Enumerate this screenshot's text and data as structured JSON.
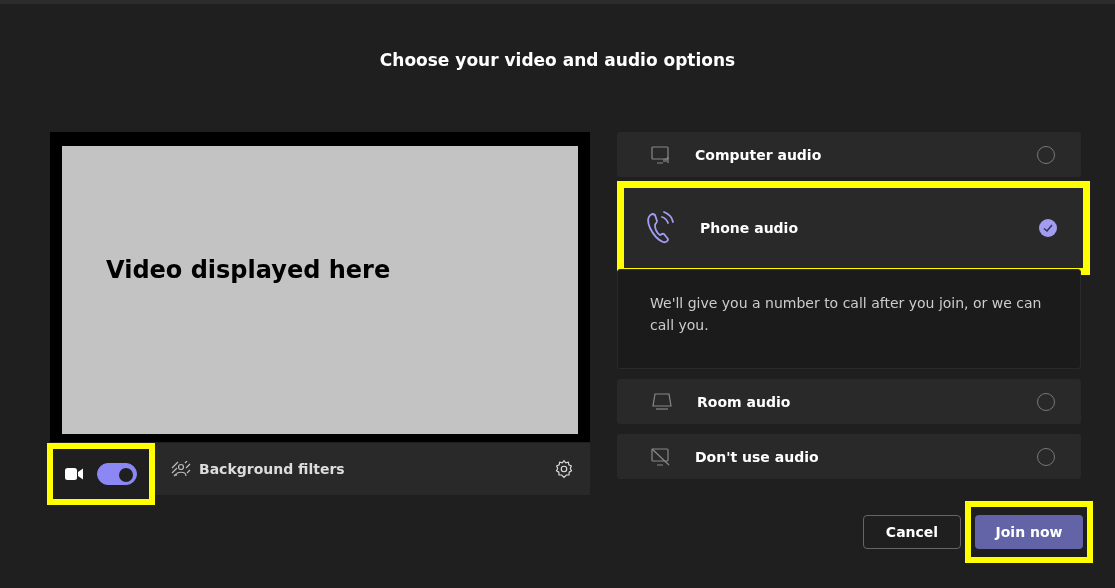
{
  "heading": "Choose your video and audio options",
  "video": {
    "placeholder": "Video displayed here"
  },
  "camera": {
    "on": true,
    "highlighted": true
  },
  "background_filters": {
    "label": "Background filters"
  },
  "audio_options": [
    {
      "kind": "computer",
      "label": "Computer audio",
      "selected": false,
      "highlighted": false
    },
    {
      "kind": "phone",
      "label": "Phone audio",
      "selected": true,
      "highlighted": true,
      "description": "We'll give you a number to call after you join, or we can call you."
    },
    {
      "kind": "room",
      "label": "Room audio",
      "selected": false,
      "highlighted": false
    },
    {
      "kind": "none",
      "label": "Don't use audio",
      "selected": false,
      "highlighted": false
    }
  ],
  "buttons": [
    {
      "kind": "secondary",
      "label": "Cancel",
      "highlighted": false
    },
    {
      "kind": "primary",
      "label": "Join now",
      "highlighted": true
    }
  ]
}
